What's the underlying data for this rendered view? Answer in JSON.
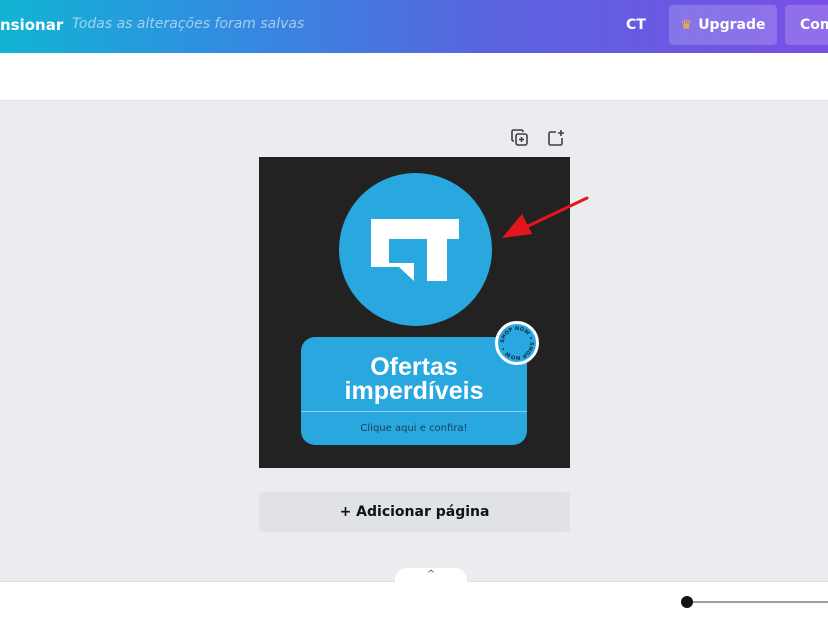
{
  "topbar": {
    "resize_label": "nsionar",
    "save_status": "Todas as alterações foram salvas",
    "team_initials": "CT",
    "upgrade_label": "Upgrade",
    "share_label": "Compartilhar"
  },
  "canvas": {
    "offer_title_line1": "Ofertas",
    "offer_title_line2": "imperdíveis",
    "offer_cta": "Clique aqui e confira!",
    "badge_text": "SHOP NOW • SHOP NOW •"
  },
  "add_page_label": "+ Adicionar página",
  "bottom_tab_icon": "^",
  "colors": {
    "brand_gradient_start": "#12b4d3",
    "brand_gradient_end": "#7a4fe6",
    "design_background": "#222222",
    "design_blue": "#29a8e0",
    "arrow_red": "#e3171b"
  },
  "icons": {
    "duplicate_page": "duplicate-page-icon",
    "add_page": "add-page-icon",
    "crown": "crown-icon"
  }
}
